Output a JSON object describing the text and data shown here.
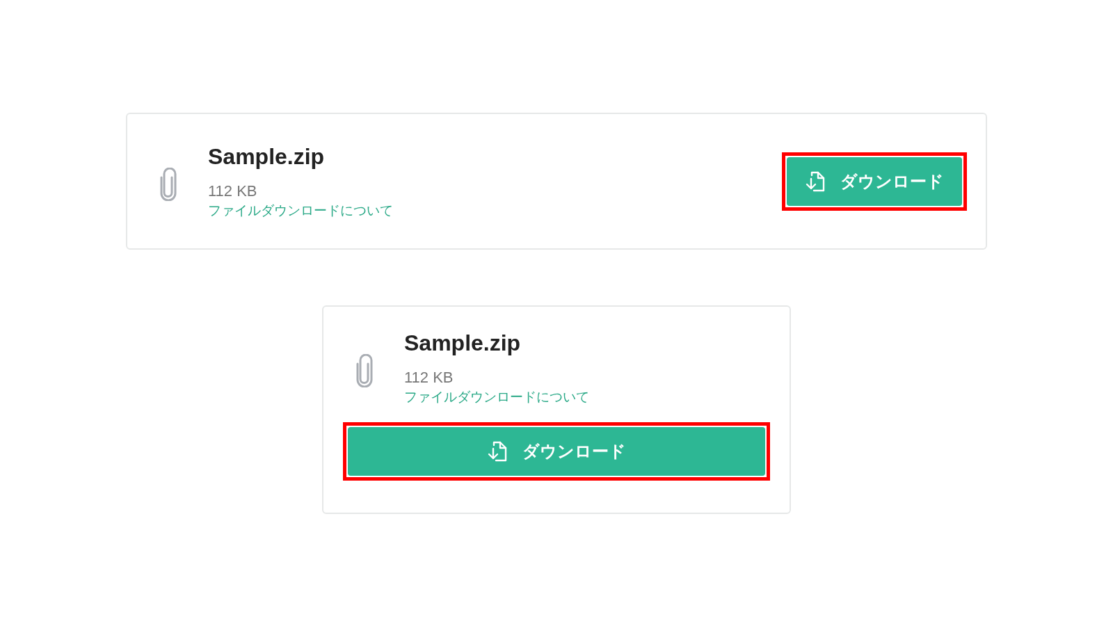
{
  "cards": [
    {
      "kind": "row",
      "file_name": "Sample.zip",
      "file_size": "112 KB",
      "help_link": "ファイルダウンロードについて",
      "button": {
        "label": "ダウンロード",
        "highlighted": true
      }
    },
    {
      "kind": "stacked",
      "file_name": "Sample.zip",
      "file_size": "112 KB",
      "help_link": "ファイルダウンロードについて",
      "button": {
        "label": "ダウンロード",
        "highlighted": true
      }
    }
  ]
}
